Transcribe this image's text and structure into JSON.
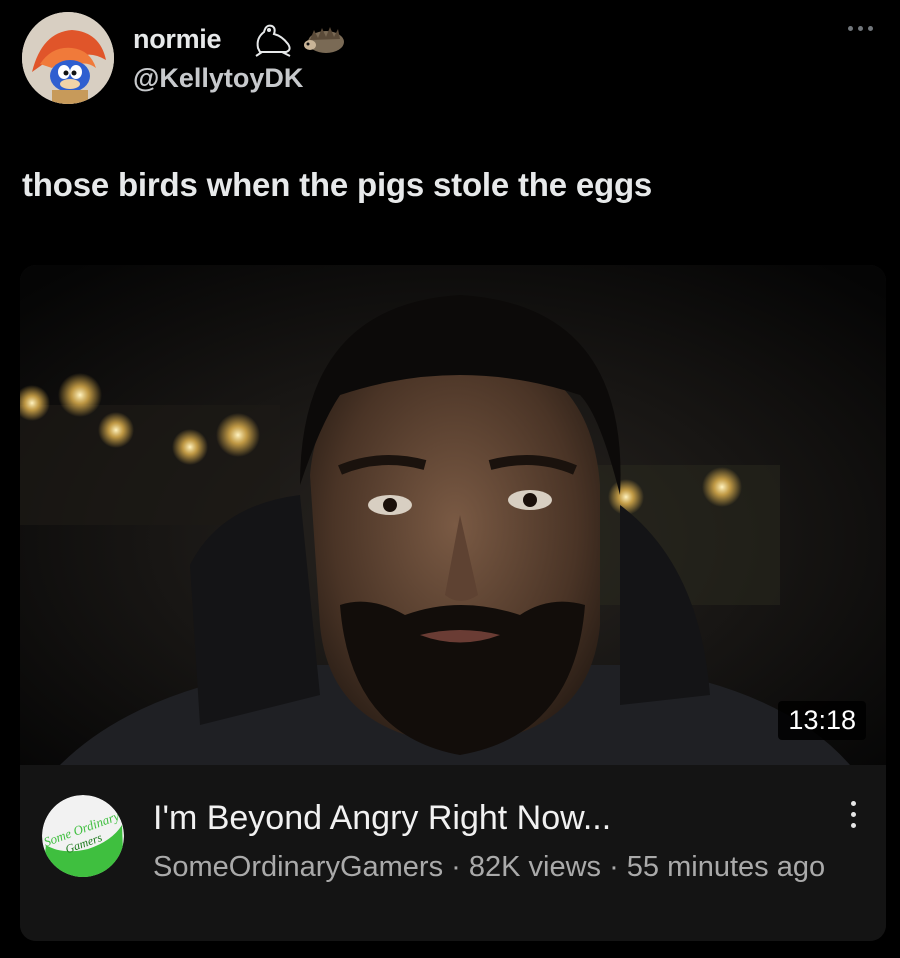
{
  "tweet": {
    "display_name": "normie",
    "handle": "@KellytoyDK",
    "name_emojis": [
      "frog-emoji",
      "hedgehog-emoji"
    ],
    "more_icon": "more-horizontal-icon",
    "text": "those birds when the pigs stole the eggs"
  },
  "video_card": {
    "duration": "13:18",
    "title": "I'm Beyond Angry Right Now...",
    "meta": "SomeOrdinaryGamers · 82K views · 55 minutes ago",
    "channel_logo_text": "Some Ordinary Gamers",
    "menu_icon": "more-vertical-icon"
  },
  "colors": {
    "background": "#000000",
    "card": "#141414",
    "channel_green": "#3fbf3f"
  }
}
